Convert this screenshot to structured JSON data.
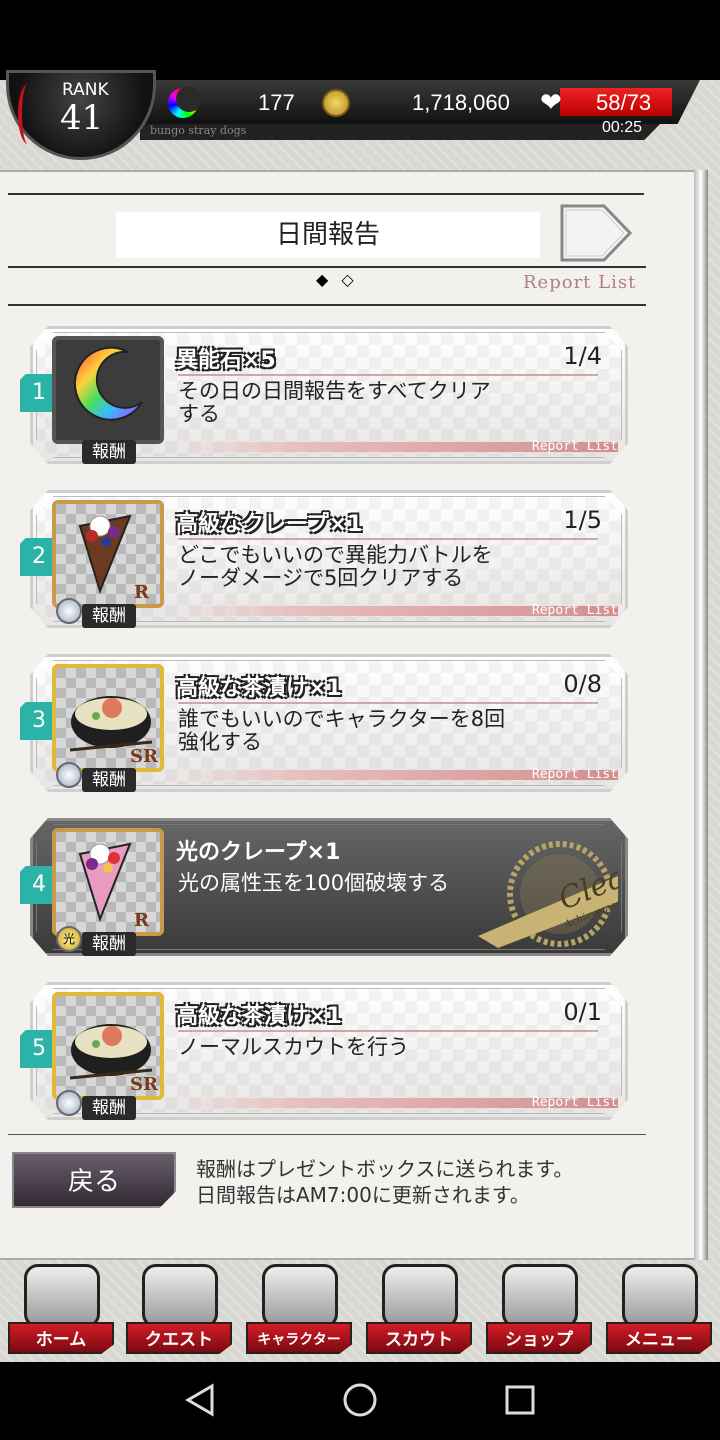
{
  "header": {
    "rank_label": "RANK",
    "rank_value": "41",
    "gems": "177",
    "coins": "1,718,060",
    "ap": "58/73",
    "ap_timer": "00:25",
    "game_name": "bungo stray dogs"
  },
  "page": {
    "title": "日間報告",
    "report_list_label": "Report List",
    "page_indicator": "◆ ◇"
  },
  "quests": [
    {
      "num": "1",
      "reward": "異能石×5",
      "count": "1/4",
      "desc": "その日の日間報告をすべてクリアする",
      "tag": "報酬",
      "rarity": "",
      "done": false
    },
    {
      "num": "2",
      "reward": "高級なクレープ×1",
      "count": "1/5",
      "desc": "どこでもいいので異能力バトルをノーダメージで5回クリアする",
      "tag": "報酬",
      "rarity": "R",
      "done": false
    },
    {
      "num": "3",
      "reward": "高級な茶漬け×1",
      "count": "0/8",
      "desc": "誰でもいいのでキャラクターを8回強化する",
      "tag": "報酬",
      "rarity": "SR",
      "done": false
    },
    {
      "num": "4",
      "reward": "光のクレープ×1",
      "count": "",
      "desc": "光の属性玉を100個破壊する",
      "tag": "報酬",
      "rarity": "R",
      "done": true
    },
    {
      "num": "5",
      "reward": "高級な茶漬け×1",
      "count": "0/1",
      "desc": "ノーマルスカウトを行う",
      "tag": "報酬",
      "rarity": "SR",
      "done": false
    }
  ],
  "card_report_label": "Report List",
  "clear_seal": {
    "text": "Clear",
    "sub": "Achievement"
  },
  "footer": {
    "back_label": "戻る",
    "info_line1": "報酬はプレゼントボックスに送られます。",
    "info_line2": "日間報告はAM7:00に更新されます。"
  },
  "nav": [
    {
      "label": "ホーム",
      "icon": "home-icon"
    },
    {
      "label": "クエスト",
      "icon": "quest-icon"
    },
    {
      "label": "キャラクター",
      "icon": "character-icon"
    },
    {
      "label": "スカウト",
      "icon": "scout-icon"
    },
    {
      "label": "ショップ",
      "icon": "shop-icon"
    },
    {
      "label": "メニュー",
      "icon": "menu-gear-icon"
    }
  ],
  "colors": {
    "accent_teal": "#2cb3a8",
    "ap_red": "#d41c27"
  }
}
